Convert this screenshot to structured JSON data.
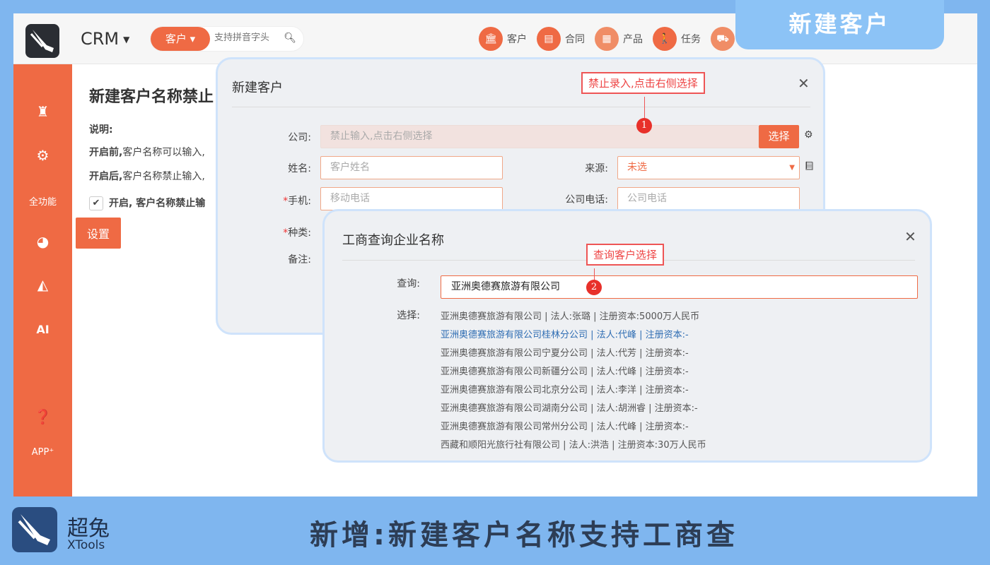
{
  "app": {
    "name": "CRM",
    "search": {
      "scope": "客户",
      "placeholder": "支持拼音字头"
    },
    "nav": [
      {
        "label": "客户",
        "icon": "bank-icon"
      },
      {
        "label": "合同",
        "icon": "document-icon"
      },
      {
        "label": "产品",
        "icon": "grid-icon"
      },
      {
        "label": "任务",
        "icon": "walker-icon"
      }
    ]
  },
  "sidebar": {
    "items": [
      {
        "icon": "castle-icon"
      },
      {
        "icon": "gears-icon"
      },
      {
        "label": "全功能"
      },
      {
        "icon": "dashboard-icon"
      },
      {
        "icon": "area-chart-icon"
      },
      {
        "label": "AI"
      },
      {
        "icon": "help-icon"
      },
      {
        "label": "APP⁺"
      }
    ]
  },
  "page": {
    "title": "新建客户名称禁止",
    "note_label": "说明:",
    "before_label": "开启前,",
    "before_text": "客户名称可以输入,",
    "after_label": "开启后,",
    "after_text": "客户名称禁止输入,",
    "check_label": "开启,  客户名称禁止输",
    "set_button": "设置"
  },
  "dialog_new": {
    "title": "新建客户",
    "company_label": "公司:",
    "company_placeholder": "禁止输入,点击右侧选择",
    "select_button": "选择",
    "name_label": "姓名:",
    "name_placeholder": "客户姓名",
    "source_label": "来源:",
    "source_value": "未选",
    "mobile_label": "手机:",
    "mobile_placeholder": "移动电话",
    "phone_label": "公司电话:",
    "phone_placeholder": "公司电话",
    "type_label": "种类:",
    "remark_label": "备注:",
    "callout": "禁止录入,点击右侧选择",
    "badge": "1"
  },
  "dialog_lookup": {
    "title": "工商查询企业名称",
    "query_label": "查询:",
    "query_value": "亚洲奥德赛旅游有限公司",
    "select_label": "选择:",
    "callout": "查询客户选择",
    "badge": "2",
    "results": [
      "亚洲奥德赛旅游有限公司 | 法人:张璐 | 注册资本:5000万人民币",
      "亚洲奥德赛旅游有限公司桂林分公司 | 法人:代峰 | 注册资本:-",
      "亚洲奥德赛旅游有限公司宁夏分公司 | 法人:代芳 | 注册资本:-",
      "亚洲奥德赛旅游有限公司新疆分公司 | 法人:代峰 | 注册资本:-",
      "亚洲奥德赛旅游有限公司北京分公司 | 法人:李洋 | 注册资本:-",
      "亚洲奥德赛旅游有限公司湖南分公司 | 法人:胡洲睿 | 注册资本:-",
      "亚洲奥德赛旅游有限公司常州分公司 | 法人:代峰 | 注册资本:-",
      "西藏和顺阳光旅行社有限公司 | 法人:洪浩 | 注册资本:30万人民币"
    ],
    "active_index": 1
  },
  "banner": {
    "tag": "新建客户",
    "brand_name": "超兔",
    "brand_sub": "XTools",
    "caption": "新增:新建客户名称支持工商查"
  },
  "colors": {
    "accent": "#ef6a44",
    "frame": "#7fb6ef",
    "highlight": "#e8302a"
  }
}
